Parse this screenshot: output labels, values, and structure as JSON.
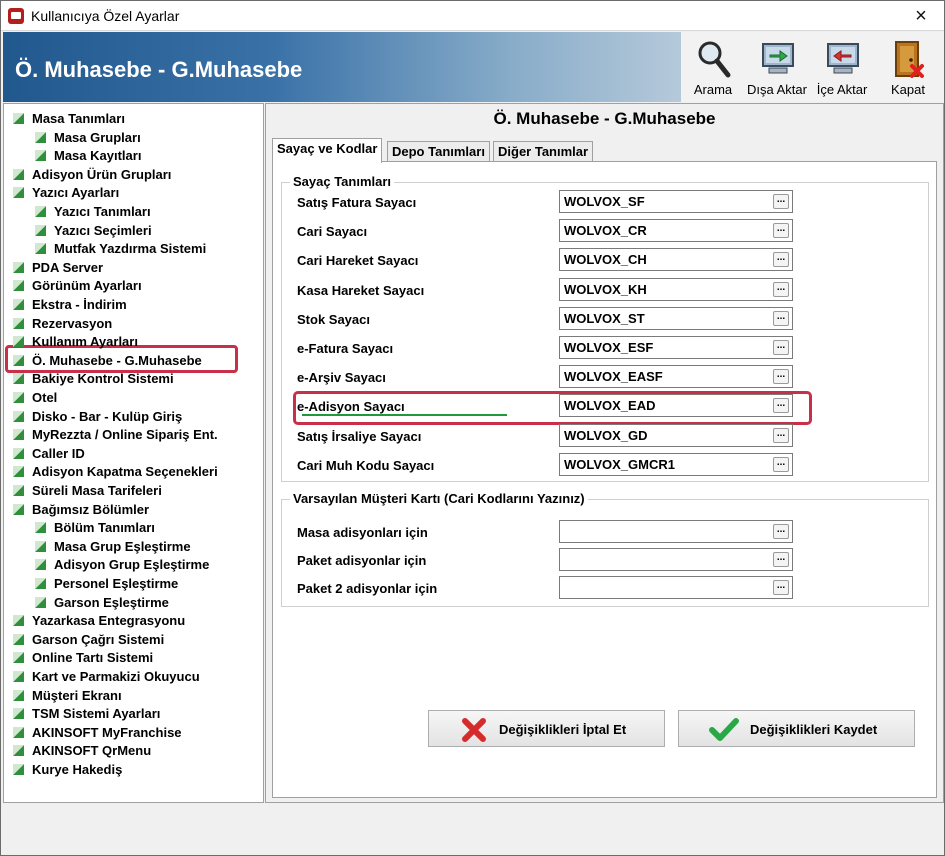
{
  "window": {
    "title": "Kullanıcıya Özel Ayarlar",
    "close": "×"
  },
  "banner": {
    "title": "Ö. Muhasebe - G.Muhasebe"
  },
  "toolbar": {
    "search": "Arama",
    "export": "Dışa Aktar",
    "import": "İçe Aktar",
    "close": "Kapat"
  },
  "tree": [
    {
      "label": "Masa Tanımları",
      "level": 0
    },
    {
      "label": "Masa Grupları",
      "level": 1
    },
    {
      "label": "Masa Kayıtları",
      "level": 1
    },
    {
      "label": "Adisyon Ürün Grupları",
      "level": 0
    },
    {
      "label": "Yazıcı Ayarları",
      "level": 0
    },
    {
      "label": "Yazıcı Tanımları",
      "level": 1
    },
    {
      "label": "Yazıcı Seçimleri",
      "level": 1
    },
    {
      "label": "Mutfak Yazdırma Sistemi",
      "level": 1
    },
    {
      "label": "PDA Server",
      "level": 0
    },
    {
      "label": "Görünüm Ayarları",
      "level": 0
    },
    {
      "label": "Ekstra - İndirim",
      "level": 0
    },
    {
      "label": "Rezervasyon",
      "level": 0
    },
    {
      "label": "Kullanım Ayarları",
      "level": 0
    },
    {
      "label": "Ö. Muhasebe - G.Muhasebe",
      "level": 0
    },
    {
      "label": "Bakiye Kontrol Sistemi",
      "level": 0
    },
    {
      "label": "Otel",
      "level": 0
    },
    {
      "label": "Disko - Bar - Kulüp Giriş",
      "level": 0
    },
    {
      "label": "MyRezzta / Online Sipariş Ent.",
      "level": 0
    },
    {
      "label": "Caller ID",
      "level": 0
    },
    {
      "label": "Adisyon Kapatma Seçenekleri",
      "level": 0
    },
    {
      "label": "Süreli Masa Tarifeleri",
      "level": 0
    },
    {
      "label": "Bağımsız Bölümler",
      "level": 0
    },
    {
      "label": "Bölüm Tanımları",
      "level": 1
    },
    {
      "label": "Masa Grup Eşleştirme",
      "level": 1
    },
    {
      "label": "Adisyon Grup Eşleştirme",
      "level": 1
    },
    {
      "label": "Personel Eşleştirme",
      "level": 1
    },
    {
      "label": "Garson Eşleştirme",
      "level": 1
    },
    {
      "label": "Yazarkasa Entegrasyonu",
      "level": 0
    },
    {
      "label": "Garson Çağrı Sistemi",
      "level": 0
    },
    {
      "label": "Online Tartı Sistemi",
      "level": 0
    },
    {
      "label": "Kart ve Parmakizi Okuyucu",
      "level": 0
    },
    {
      "label": "Müşteri Ekranı",
      "level": 0
    },
    {
      "label": "TSM Sistemi Ayarları",
      "level": 0
    },
    {
      "label": "AKINSOFT MyFranchise",
      "level": 0
    },
    {
      "label": "AKINSOFT QrMenu",
      "level": 0
    },
    {
      "label": "Kurye Hakediş",
      "level": 0
    }
  ],
  "panel": {
    "title": "Ö. Muhasebe - G.Muhasebe",
    "tabs": [
      "Sayaç ve Kodlar",
      "Depo Tanımları",
      "Diğer Tanımlar"
    ],
    "group1": {
      "title": "Sayaç Tanımları",
      "rows": [
        {
          "label": "Satış Fatura Sayacı",
          "value": "WOLVOX_SF"
        },
        {
          "label": "Cari Sayacı",
          "value": "WOLVOX_CR"
        },
        {
          "label": "Cari Hareket Sayacı",
          "value": "WOLVOX_CH"
        },
        {
          "label": "Kasa Hareket Sayacı",
          "value": "WOLVOX_KH"
        },
        {
          "label": "Stok Sayacı",
          "value": "WOLVOX_ST"
        },
        {
          "label": "e-Fatura Sayacı",
          "value": "WOLVOX_ESF"
        },
        {
          "label": "e-Arşiv Sayacı",
          "value": "WOLVOX_EASF"
        },
        {
          "label": "e-Adisyon Sayacı",
          "value": "WOLVOX_EAD"
        },
        {
          "label": "Satış İrsaliye Sayacı",
          "value": "WOLVOX_GD"
        },
        {
          "label": "Cari Muh Kodu Sayacı",
          "value": "WOLVOX_GMCR1"
        }
      ]
    },
    "group2": {
      "title": "Varsayılan Müşteri Kartı (Cari Kodlarını Yazınız)",
      "rows": [
        {
          "label": "Masa adisyonları için",
          "value": ""
        },
        {
          "label": "Paket adisyonlar için",
          "value": ""
        },
        {
          "label": "Paket 2 adisyonlar için",
          "value": ""
        }
      ]
    },
    "ellipsis": "..."
  },
  "buttons": {
    "cancel": "Değişiklikleri İptal Et",
    "save": "Değişiklikleri Kaydet"
  }
}
